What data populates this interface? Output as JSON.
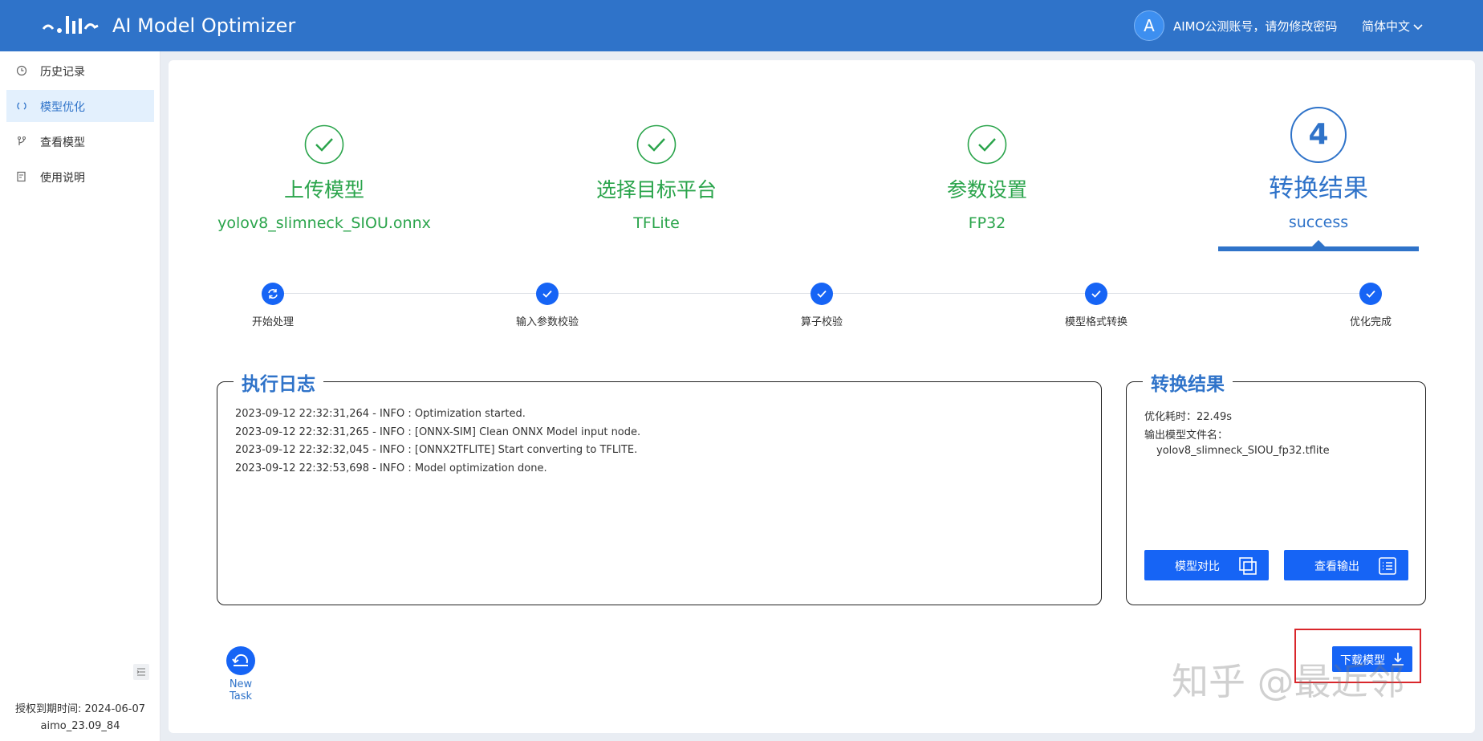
{
  "header": {
    "title": "AI Model Optimizer",
    "avatar_letter": "A",
    "account": "AIMO公测账号，请勿修改密码",
    "language": "简体中文"
  },
  "sidebar": {
    "items": [
      {
        "label": "历史记录",
        "icon": "history-icon",
        "active": false
      },
      {
        "label": "模型优化",
        "icon": "optimize-icon",
        "active": true
      },
      {
        "label": "查看模型",
        "icon": "view-model-icon",
        "active": false
      },
      {
        "label": "使用说明",
        "icon": "manual-icon",
        "active": false
      }
    ],
    "license": "授权到期时间: 2024-06-07",
    "version": "aimo_23.09_84"
  },
  "steps": [
    {
      "title": "上传模型",
      "value": "yolov8_slimneck_SIOU.onnx",
      "state": "done"
    },
    {
      "title": "选择目标平台",
      "value": "TFLite",
      "state": "done"
    },
    {
      "title": "参数设置",
      "value": "FP32",
      "state": "done"
    },
    {
      "number": "4",
      "title": "转换结果",
      "value": "success",
      "state": "current"
    }
  ],
  "progress": [
    {
      "label": "开始处理",
      "state": "loading"
    },
    {
      "label": "输入参数校验",
      "state": "done"
    },
    {
      "label": "算子校验",
      "state": "done"
    },
    {
      "label": "模型格式转换",
      "state": "done"
    },
    {
      "label": "优化完成",
      "state": "done"
    }
  ],
  "log": {
    "title": "执行日志",
    "lines": [
      "2023-09-12 22:32:31,264 - INFO : Optimization started.",
      "2023-09-12 22:32:31,265 - INFO : [ONNX-SIM] Clean ONNX Model input node.",
      "2023-09-12 22:32:32,045 - INFO : [ONNX2TFLITE] Start converting to TFLITE.",
      "2023-09-12 22:32:53,698 - INFO : Model optimization done."
    ]
  },
  "result": {
    "title": "转换结果",
    "time_label": "优化耗时：",
    "time_value": "22.49s",
    "file_label": "输出模型文件名：",
    "file_value": "yolov8_slimneck_SIOU_fp32.tflite",
    "compare_btn": "模型对比",
    "output_btn": "查看输出"
  },
  "actions": {
    "new_task": "New Task",
    "download": "下载模型"
  },
  "watermark": "知乎 @最近邻",
  "colors": {
    "primary": "#2f73c9",
    "button": "#1664f5",
    "success": "#2aa44b",
    "highlight": "#d9262b"
  }
}
